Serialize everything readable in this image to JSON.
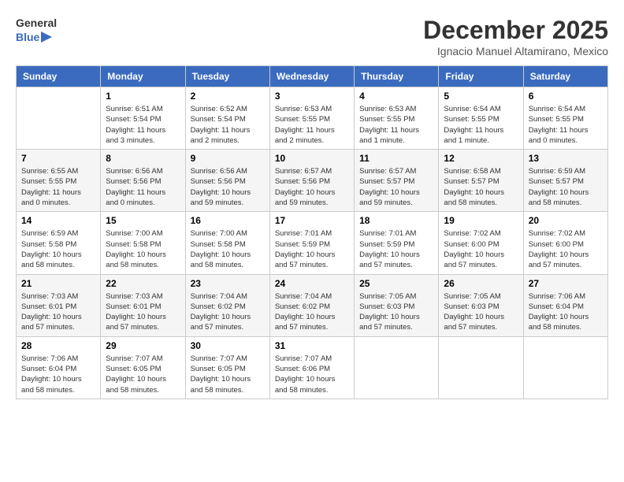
{
  "header": {
    "logo_line1": "General",
    "logo_line2": "Blue",
    "month": "December 2025",
    "location": "Ignacio Manuel Altamirano, Mexico"
  },
  "weekdays": [
    "Sunday",
    "Monday",
    "Tuesday",
    "Wednesday",
    "Thursday",
    "Friday",
    "Saturday"
  ],
  "weeks": [
    [
      {
        "day": "",
        "sunrise": "",
        "sunset": "",
        "daylight": ""
      },
      {
        "day": "1",
        "sunrise": "Sunrise: 6:51 AM",
        "sunset": "Sunset: 5:54 PM",
        "daylight": "Daylight: 11 hours and 3 minutes."
      },
      {
        "day": "2",
        "sunrise": "Sunrise: 6:52 AM",
        "sunset": "Sunset: 5:54 PM",
        "daylight": "Daylight: 11 hours and 2 minutes."
      },
      {
        "day": "3",
        "sunrise": "Sunrise: 6:53 AM",
        "sunset": "Sunset: 5:55 PM",
        "daylight": "Daylight: 11 hours and 2 minutes."
      },
      {
        "day": "4",
        "sunrise": "Sunrise: 6:53 AM",
        "sunset": "Sunset: 5:55 PM",
        "daylight": "Daylight: 11 hours and 1 minute."
      },
      {
        "day": "5",
        "sunrise": "Sunrise: 6:54 AM",
        "sunset": "Sunset: 5:55 PM",
        "daylight": "Daylight: 11 hours and 1 minute."
      },
      {
        "day": "6",
        "sunrise": "Sunrise: 6:54 AM",
        "sunset": "Sunset: 5:55 PM",
        "daylight": "Daylight: 11 hours and 0 minutes."
      }
    ],
    [
      {
        "day": "7",
        "sunrise": "Sunrise: 6:55 AM",
        "sunset": "Sunset: 5:55 PM",
        "daylight": "Daylight: 11 hours and 0 minutes."
      },
      {
        "day": "8",
        "sunrise": "Sunrise: 6:56 AM",
        "sunset": "Sunset: 5:56 PM",
        "daylight": "Daylight: 11 hours and 0 minutes."
      },
      {
        "day": "9",
        "sunrise": "Sunrise: 6:56 AM",
        "sunset": "Sunset: 5:56 PM",
        "daylight": "Daylight: 10 hours and 59 minutes."
      },
      {
        "day": "10",
        "sunrise": "Sunrise: 6:57 AM",
        "sunset": "Sunset: 5:56 PM",
        "daylight": "Daylight: 10 hours and 59 minutes."
      },
      {
        "day": "11",
        "sunrise": "Sunrise: 6:57 AM",
        "sunset": "Sunset: 5:57 PM",
        "daylight": "Daylight: 10 hours and 59 minutes."
      },
      {
        "day": "12",
        "sunrise": "Sunrise: 6:58 AM",
        "sunset": "Sunset: 5:57 PM",
        "daylight": "Daylight: 10 hours and 58 minutes."
      },
      {
        "day": "13",
        "sunrise": "Sunrise: 6:59 AM",
        "sunset": "Sunset: 5:57 PM",
        "daylight": "Daylight: 10 hours and 58 minutes."
      }
    ],
    [
      {
        "day": "14",
        "sunrise": "Sunrise: 6:59 AM",
        "sunset": "Sunset: 5:58 PM",
        "daylight": "Daylight: 10 hours and 58 minutes."
      },
      {
        "day": "15",
        "sunrise": "Sunrise: 7:00 AM",
        "sunset": "Sunset: 5:58 PM",
        "daylight": "Daylight: 10 hours and 58 minutes."
      },
      {
        "day": "16",
        "sunrise": "Sunrise: 7:00 AM",
        "sunset": "Sunset: 5:58 PM",
        "daylight": "Daylight: 10 hours and 58 minutes."
      },
      {
        "day": "17",
        "sunrise": "Sunrise: 7:01 AM",
        "sunset": "Sunset: 5:59 PM",
        "daylight": "Daylight: 10 hours and 57 minutes."
      },
      {
        "day": "18",
        "sunrise": "Sunrise: 7:01 AM",
        "sunset": "Sunset: 5:59 PM",
        "daylight": "Daylight: 10 hours and 57 minutes."
      },
      {
        "day": "19",
        "sunrise": "Sunrise: 7:02 AM",
        "sunset": "Sunset: 6:00 PM",
        "daylight": "Daylight: 10 hours and 57 minutes."
      },
      {
        "day": "20",
        "sunrise": "Sunrise: 7:02 AM",
        "sunset": "Sunset: 6:00 PM",
        "daylight": "Daylight: 10 hours and 57 minutes."
      }
    ],
    [
      {
        "day": "21",
        "sunrise": "Sunrise: 7:03 AM",
        "sunset": "Sunset: 6:01 PM",
        "daylight": "Daylight: 10 hours and 57 minutes."
      },
      {
        "day": "22",
        "sunrise": "Sunrise: 7:03 AM",
        "sunset": "Sunset: 6:01 PM",
        "daylight": "Daylight: 10 hours and 57 minutes."
      },
      {
        "day": "23",
        "sunrise": "Sunrise: 7:04 AM",
        "sunset": "Sunset: 6:02 PM",
        "daylight": "Daylight: 10 hours and 57 minutes."
      },
      {
        "day": "24",
        "sunrise": "Sunrise: 7:04 AM",
        "sunset": "Sunset: 6:02 PM",
        "daylight": "Daylight: 10 hours and 57 minutes."
      },
      {
        "day": "25",
        "sunrise": "Sunrise: 7:05 AM",
        "sunset": "Sunset: 6:03 PM",
        "daylight": "Daylight: 10 hours and 57 minutes."
      },
      {
        "day": "26",
        "sunrise": "Sunrise: 7:05 AM",
        "sunset": "Sunset: 6:03 PM",
        "daylight": "Daylight: 10 hours and 57 minutes."
      },
      {
        "day": "27",
        "sunrise": "Sunrise: 7:06 AM",
        "sunset": "Sunset: 6:04 PM",
        "daylight": "Daylight: 10 hours and 58 minutes."
      }
    ],
    [
      {
        "day": "28",
        "sunrise": "Sunrise: 7:06 AM",
        "sunset": "Sunset: 6:04 PM",
        "daylight": "Daylight: 10 hours and 58 minutes."
      },
      {
        "day": "29",
        "sunrise": "Sunrise: 7:07 AM",
        "sunset": "Sunset: 6:05 PM",
        "daylight": "Daylight: 10 hours and 58 minutes."
      },
      {
        "day": "30",
        "sunrise": "Sunrise: 7:07 AM",
        "sunset": "Sunset: 6:05 PM",
        "daylight": "Daylight: 10 hours and 58 minutes."
      },
      {
        "day": "31",
        "sunrise": "Sunrise: 7:07 AM",
        "sunset": "Sunset: 6:06 PM",
        "daylight": "Daylight: 10 hours and 58 minutes."
      },
      {
        "day": "",
        "sunrise": "",
        "sunset": "",
        "daylight": ""
      },
      {
        "day": "",
        "sunrise": "",
        "sunset": "",
        "daylight": ""
      },
      {
        "day": "",
        "sunrise": "",
        "sunset": "",
        "daylight": ""
      }
    ]
  ]
}
